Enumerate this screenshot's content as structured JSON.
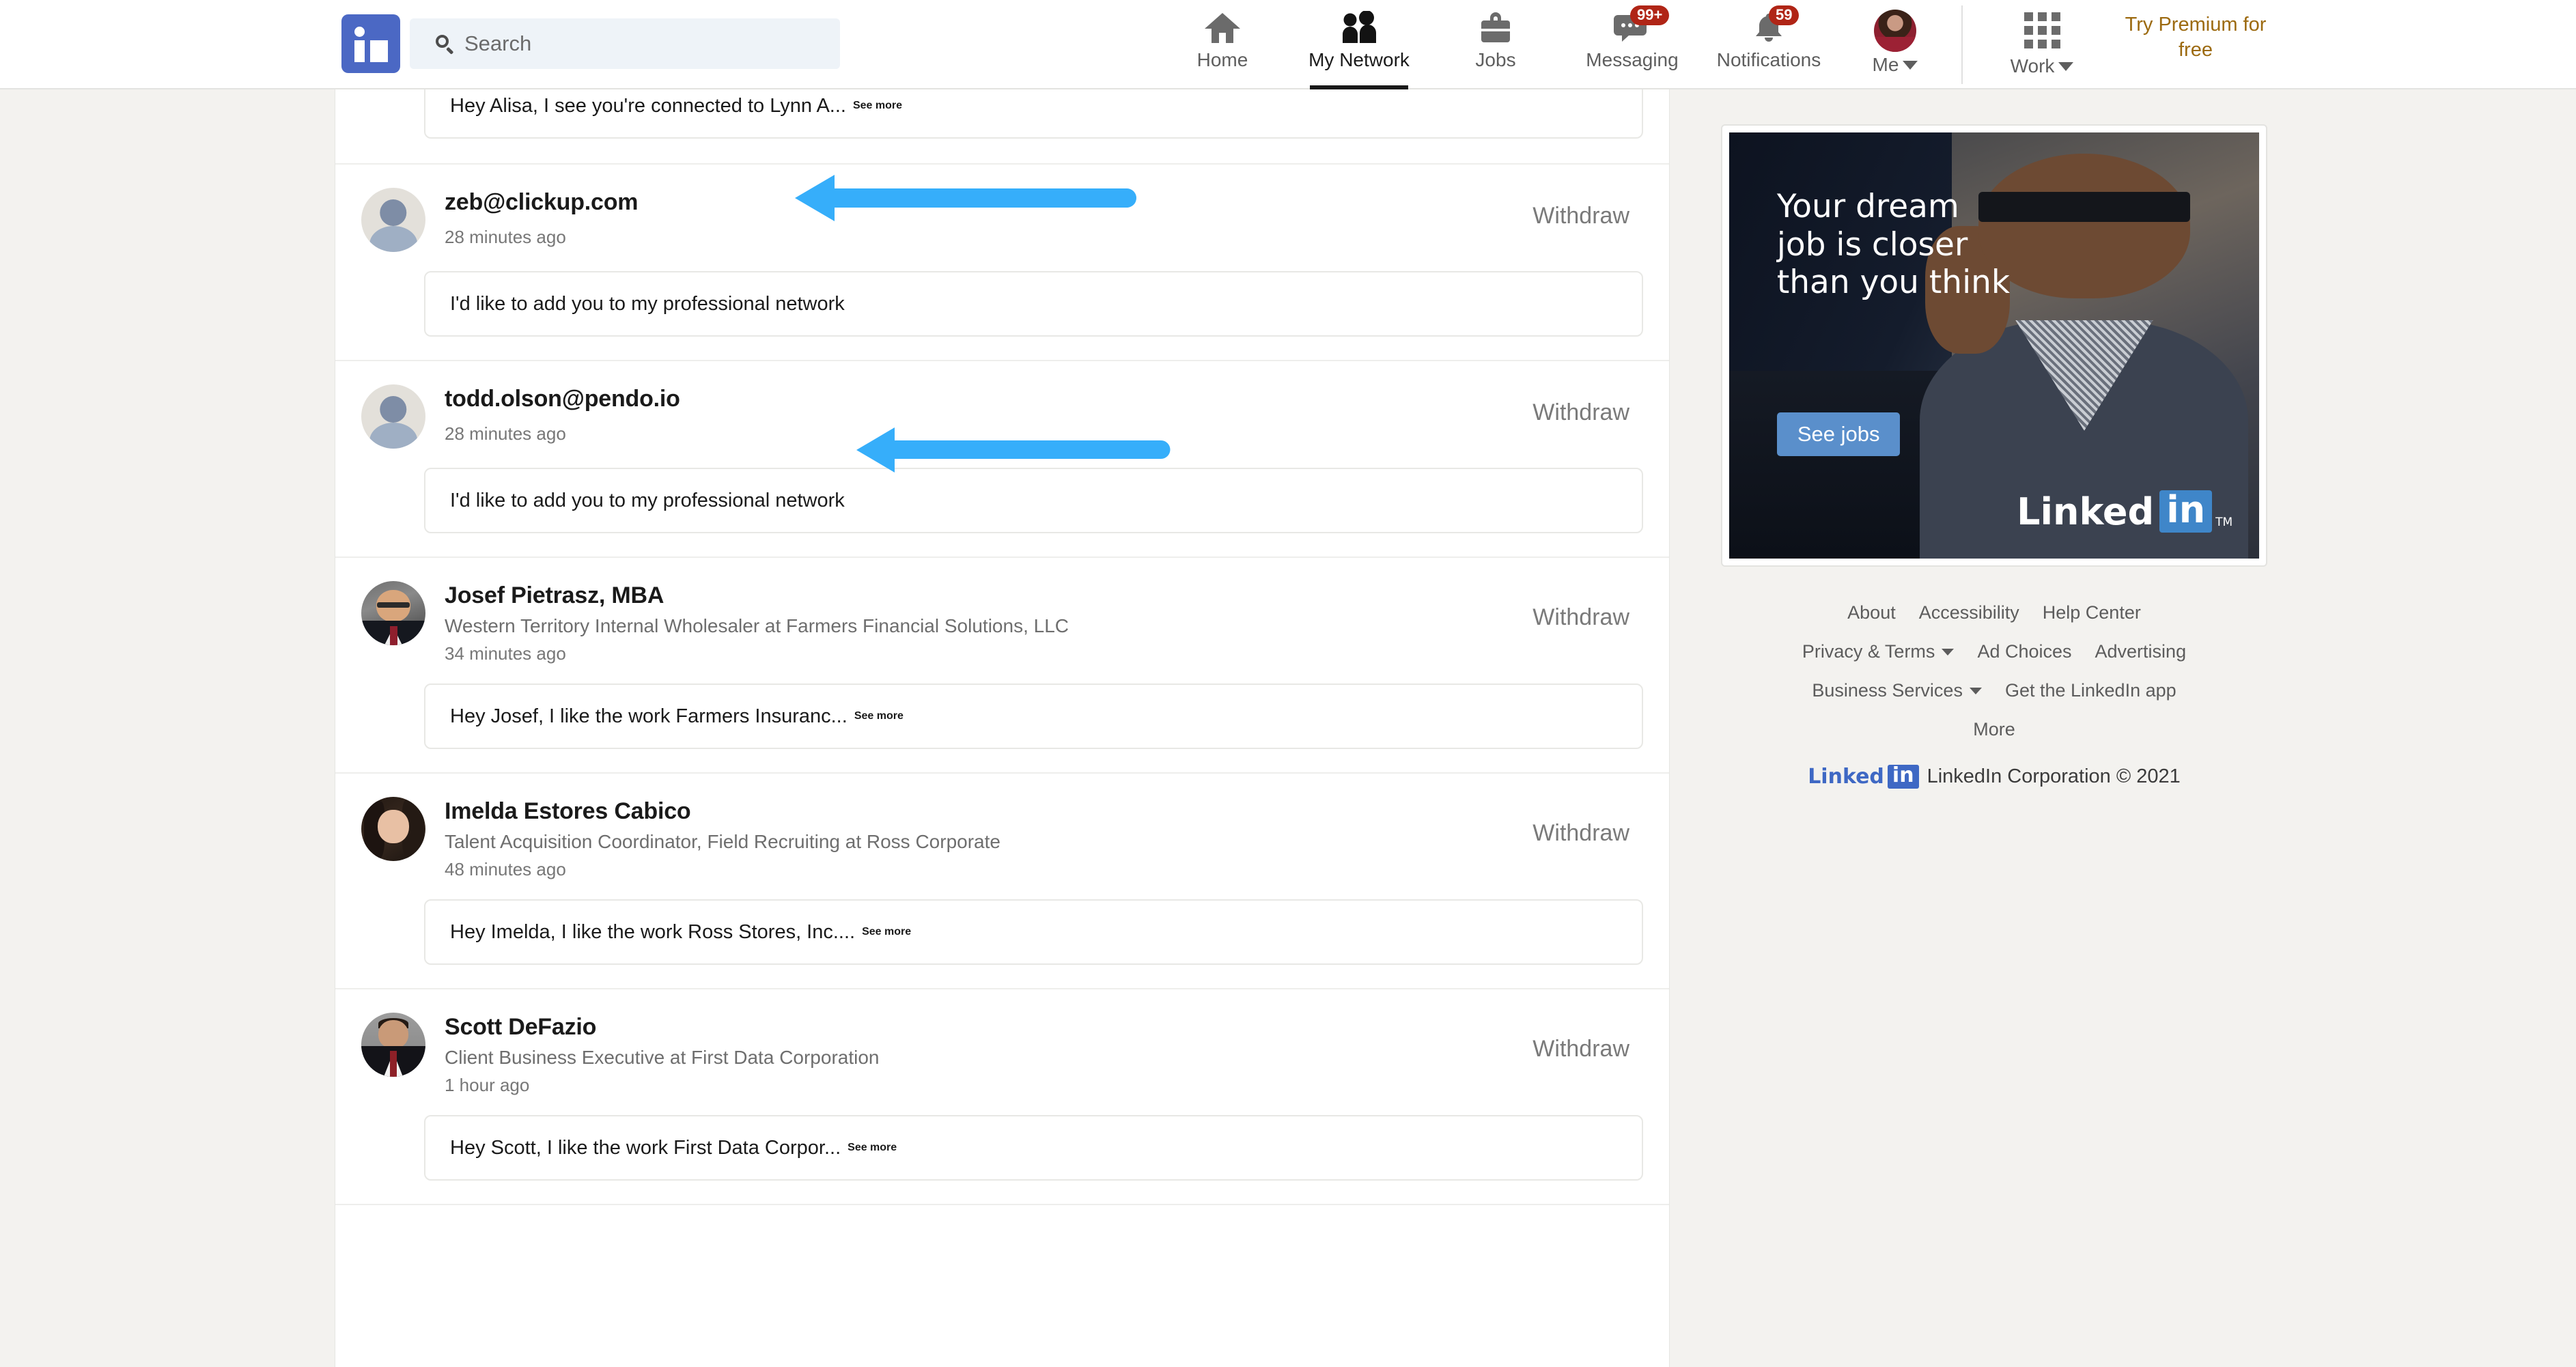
{
  "header": {
    "logo_alt": "linkedin-logo",
    "search": {
      "placeholder": "Search"
    },
    "nav": [
      {
        "label": "Home",
        "icon": "home-icon",
        "active": false,
        "badge": null
      },
      {
        "label": "My Network",
        "icon": "network-icon",
        "active": true,
        "badge": null
      },
      {
        "label": "Jobs",
        "icon": "jobs-icon",
        "active": false,
        "badge": null
      },
      {
        "label": "Messaging",
        "icon": "messaging-icon",
        "active": false,
        "badge": "99+"
      },
      {
        "label": "Notifications",
        "icon": "bell-icon",
        "active": false,
        "badge": "59"
      }
    ],
    "me": {
      "label": "Me"
    },
    "work": {
      "label": "Work"
    },
    "try_premium": "Try Premium for free"
  },
  "feed": {
    "partial_top": {
      "message": "Hey Alisa, I see you're connected to Lynn A...",
      "see_more": "See more"
    },
    "withdraw_label": "Withdraw",
    "see_more_label": "See more",
    "invitations": [
      {
        "name": "zeb@clickup.com",
        "title": "",
        "time": "28 minutes ago",
        "message": "I'd like to add you to my professional network",
        "see_more": false,
        "avatar": "placeholder-avatar",
        "arrow": true
      },
      {
        "name": "todd.olson@pendo.io",
        "title": "",
        "time": "28 minutes ago",
        "message": "I'd like to add you to my professional network",
        "see_more": false,
        "avatar": "placeholder-avatar",
        "arrow": true
      },
      {
        "name": "Josef Pietrasz, MBA",
        "title": "Western Territory Internal Wholesaler at Farmers Financial Solutions, LLC",
        "time": "34 minutes ago",
        "message": "Hey Josef, I like the work Farmers Insuranc...",
        "see_more": true,
        "avatar": "photo-avatar-josef",
        "arrow": false
      },
      {
        "name": "Imelda Estores Cabico",
        "title": "Talent Acquisition Coordinator, Field Recruiting at Ross Corporate",
        "time": "48 minutes ago",
        "message": "Hey Imelda, I like the work Ross Stores, Inc....",
        "see_more": true,
        "avatar": "photo-avatar-imelda",
        "arrow": false
      },
      {
        "name": "Scott DeFazio",
        "title": "Client Business Executive at First Data Corporation",
        "time": "1 hour ago",
        "message": "Hey Scott, I like the work First Data Corpor...",
        "see_more": true,
        "avatar": "photo-avatar-scott",
        "arrow": false
      }
    ]
  },
  "ad": {
    "headline": "Your dream job is closer than you think",
    "button": "See jobs",
    "logo_text": "Linked",
    "logo_in": "in",
    "logo_tm": "TM"
  },
  "footer": {
    "row1": [
      "About",
      "Accessibility",
      "Help Center"
    ],
    "row2": [
      "Privacy & Terms",
      "Ad Choices",
      "Advertising"
    ],
    "row3": [
      "Business Services",
      "Get the LinkedIn app"
    ],
    "row4": [
      "More"
    ],
    "logo_text": "Linked",
    "logo_in": "in",
    "copyright": "LinkedIn Corporation © 2021"
  },
  "annotations": {
    "arrow_color": "#36AEFA"
  }
}
